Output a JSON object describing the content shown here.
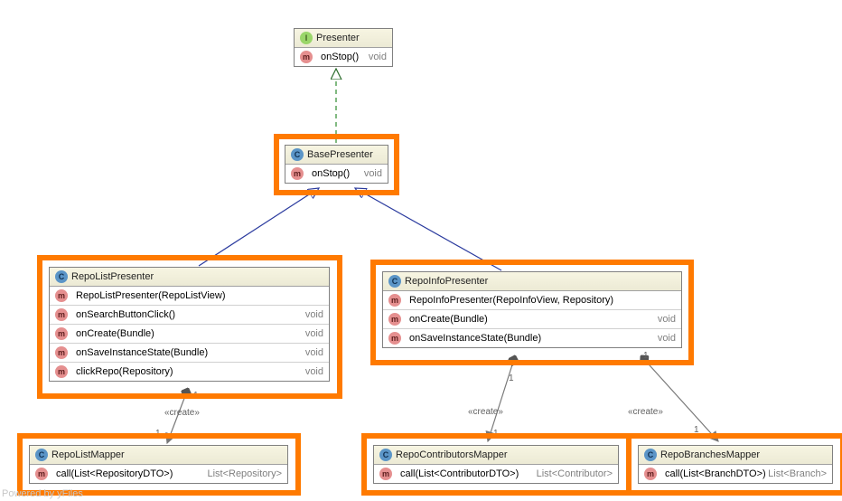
{
  "classes": {
    "presenter": {
      "name": "Presenter",
      "methods": [
        {
          "icon": "m",
          "sig": "onStop()",
          "ret": "void"
        }
      ]
    },
    "basePresenter": {
      "name": "BasePresenter",
      "methods": [
        {
          "icon": "m",
          "sig": "onStop()",
          "ret": "void"
        }
      ]
    },
    "repoListPresenter": {
      "name": "RepoListPresenter",
      "methods": [
        {
          "icon": "m",
          "sig": "RepoListPresenter(RepoListView)",
          "ret": ""
        },
        {
          "icon": "m",
          "sig": "onSearchButtonClick()",
          "ret": "void"
        },
        {
          "icon": "m",
          "sig": "onCreate(Bundle)",
          "ret": "void"
        },
        {
          "icon": "m",
          "sig": "onSaveInstanceState(Bundle)",
          "ret": "void"
        },
        {
          "icon": "m",
          "sig": "clickRepo(Repository)",
          "ret": "void"
        }
      ]
    },
    "repoInfoPresenter": {
      "name": "RepoInfoPresenter",
      "methods": [
        {
          "icon": "m",
          "sig": "RepoInfoPresenter(RepoInfoView, Repository)",
          "ret": ""
        },
        {
          "icon": "m",
          "sig": "onCreate(Bundle)",
          "ret": "void"
        },
        {
          "icon": "m",
          "sig": "onSaveInstanceState(Bundle)",
          "ret": "void"
        }
      ]
    },
    "repoListMapper": {
      "name": "RepoListMapper",
      "methods": [
        {
          "icon": "m",
          "sig": "call(List<RepositoryDTO>)",
          "ret": "List<Repository>"
        }
      ]
    },
    "repoContributorsMapper": {
      "name": "RepoContributorsMapper",
      "methods": [
        {
          "icon": "m",
          "sig": "call(List<ContributorDTO>)",
          "ret": "List<Contributor>"
        }
      ]
    },
    "repoBranchesMapper": {
      "name": "RepoBranchesMapper",
      "methods": [
        {
          "icon": "m",
          "sig": "call(List<BranchDTO>)",
          "ret": "List<Branch>"
        }
      ]
    }
  },
  "stereotypes": {
    "create1": "«create»",
    "create2": "«create»",
    "create3": "«create»"
  },
  "multiplicities": {
    "one": "1"
  },
  "watermark": "Powered by yFiles"
}
